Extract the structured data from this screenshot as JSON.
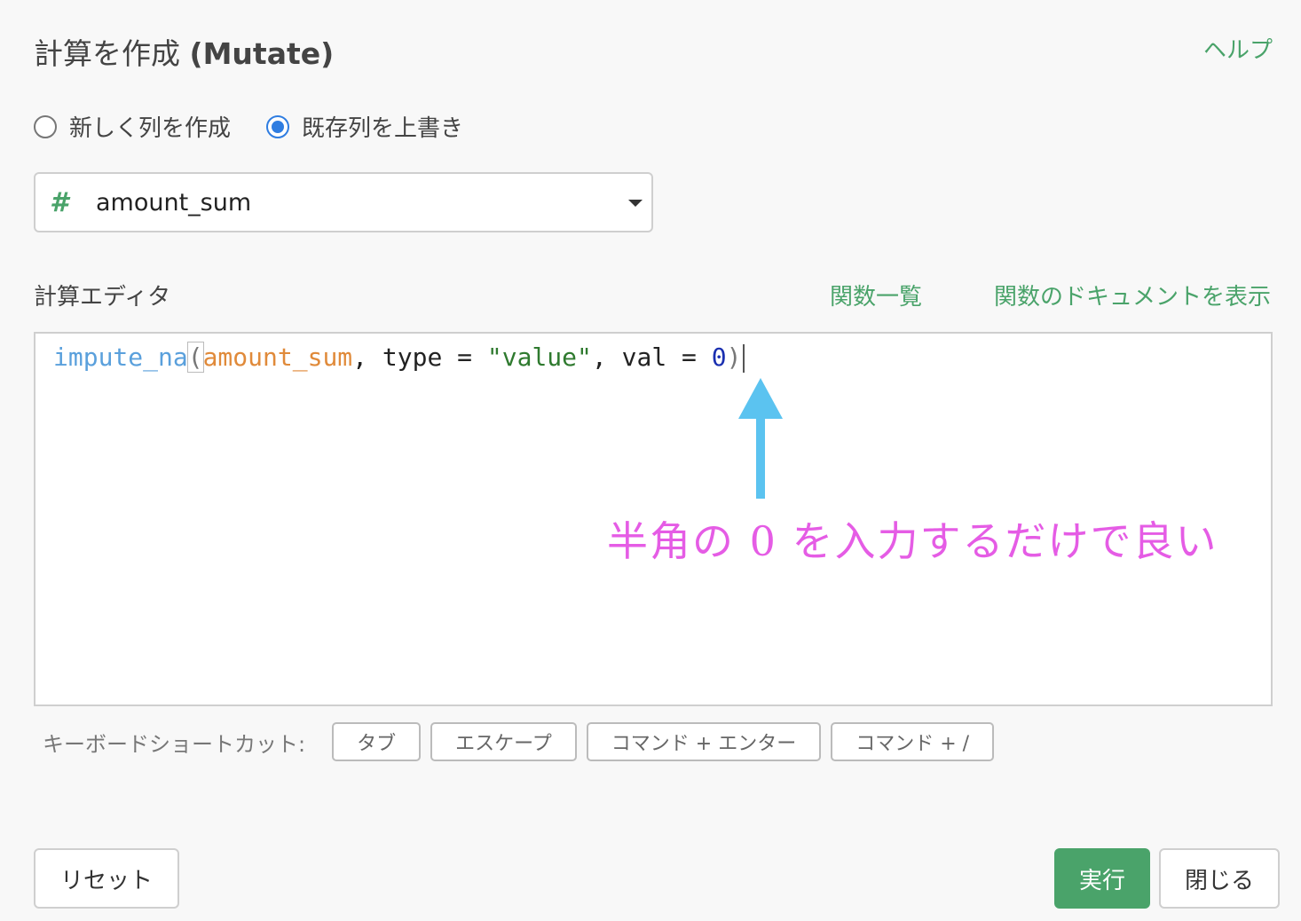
{
  "dialog": {
    "title_jp": "計算を作成",
    "title_en": "(Mutate)",
    "help_link": "ヘルプ"
  },
  "mode": {
    "options": [
      {
        "label": "新しく列を作成",
        "checked": false
      },
      {
        "label": "既存列を上書き",
        "checked": true
      }
    ]
  },
  "column_select": {
    "type_icon": "#",
    "value": "amount_sum"
  },
  "editor": {
    "label": "計算エディタ",
    "func_list_link": "関数一覧",
    "func_doc_link": "関数のドキュメントを表示",
    "code_tokens": {
      "fn": "impute_na",
      "open_paren": "(",
      "arg1": "amount_sum",
      "sep1": ", type = ",
      "str": "\"value\"",
      "sep2": ", val = ",
      "num": "0",
      "close_paren": ")"
    },
    "annotation": "半角の 0 を入力するだけで良い",
    "annotation_color": "#e55ce5",
    "arrow_color": "#5bc3f0"
  },
  "shortcuts": {
    "label": "キーボードショートカット:",
    "buttons": [
      "タブ",
      "エスケープ",
      "コマンド + エンター",
      "コマンド + /"
    ]
  },
  "footer": {
    "reset_label": "リセット",
    "run_label": "実行",
    "close_label": "閉じる",
    "accent_color": "#4aa36a"
  }
}
